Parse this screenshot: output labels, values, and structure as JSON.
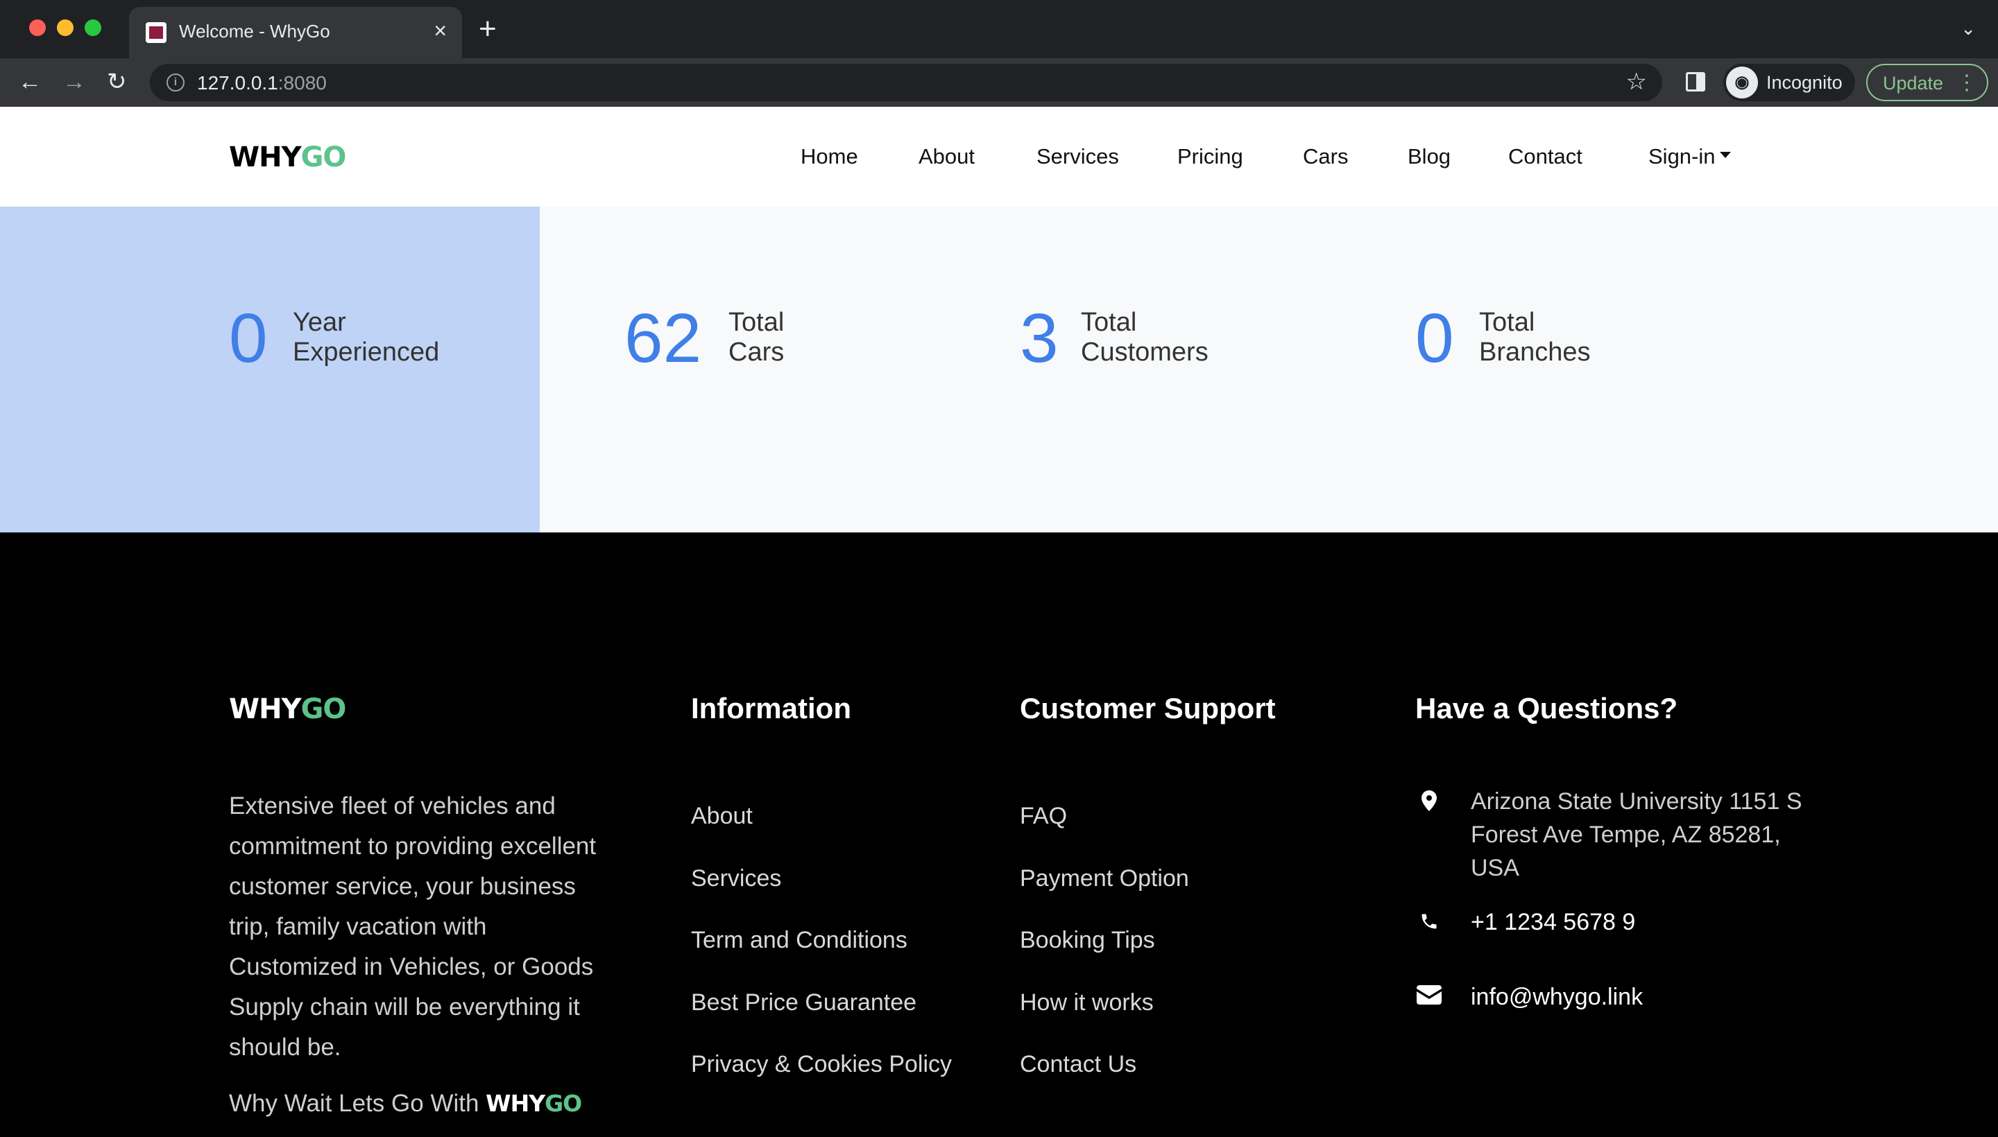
{
  "browser": {
    "tab_title": "Welcome - WhyGo",
    "url_host": "127.0.0.1",
    "url_port": ":8080",
    "profile_label": "Incognito",
    "update_label": "Update"
  },
  "nav": {
    "logo_why": "WHY",
    "logo_go": "GO",
    "links": [
      "Home",
      "About",
      "Services",
      "Pricing",
      "Cars",
      "Blog",
      "Contact",
      "Sign-in"
    ]
  },
  "counters": [
    {
      "value": "0",
      "label_line1": "Year",
      "label_line2": "Experienced"
    },
    {
      "value": "62",
      "label_line1": "Total",
      "label_line2": "Cars"
    },
    {
      "value": "3",
      "label_line1": "Total",
      "label_line2": "Customers"
    },
    {
      "value": "0",
      "label_line1": "Total",
      "label_line2": "Branches"
    }
  ],
  "footer": {
    "logo_why": "WHY",
    "logo_go": "GO",
    "description": "Extensive fleet of vehicles and commitment to providing excellent customer service, your business trip, family vacation with Customized in Vehicles, or Goods Supply chain will be everything it should be.",
    "tagline_prefix": "Why Wait Lets Go With ",
    "information": {
      "heading": "Information",
      "links": [
        "About",
        "Services",
        "Term and Conditions",
        "Best Price Guarantee",
        "Privacy & Cookies Policy"
      ]
    },
    "support": {
      "heading": "Customer Support",
      "links": [
        "FAQ",
        "Payment Option",
        "Booking Tips",
        "How it works",
        "Contact Us"
      ]
    },
    "contact": {
      "heading": "Have a Questions?",
      "address": "Arizona State University 1151 S Forest Ave Tempe, AZ 85281, USA",
      "phone": "+1 1234 5678 9",
      "email": "info@whygo.link"
    }
  },
  "colors": {
    "accent_blue": "#3f7fe7",
    "brand_green": "#5cc38a",
    "counter_highlight": "#bfd3f6"
  }
}
